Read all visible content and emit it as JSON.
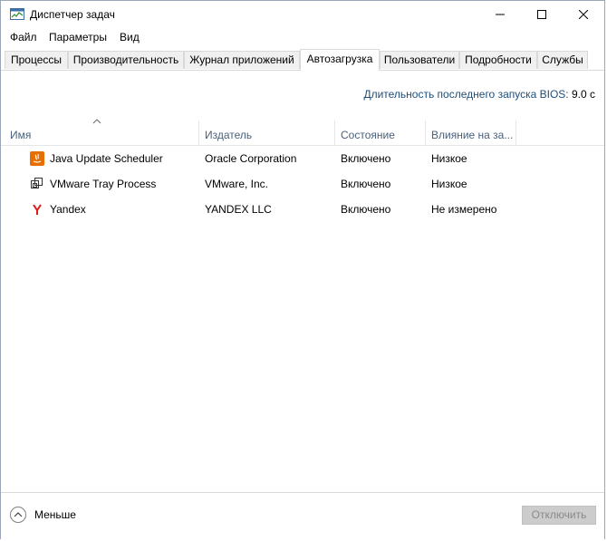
{
  "window": {
    "title": "Диспетчер задач"
  },
  "menu": [
    "Файл",
    "Параметры",
    "Вид"
  ],
  "tabs": [
    {
      "label": "Процессы",
      "active": false
    },
    {
      "label": "Производительность",
      "active": false
    },
    {
      "label": "Журнал приложений",
      "active": false
    },
    {
      "label": "Автозагрузка",
      "active": true
    },
    {
      "label": "Пользователи",
      "active": false
    },
    {
      "label": "Подробности",
      "active": false
    },
    {
      "label": "Службы",
      "active": false
    }
  ],
  "bios": {
    "label": "Длительность последнего запуска BIOS:",
    "value": "9.0 с"
  },
  "table": {
    "columns": [
      "Имя",
      "Издатель",
      "Состояние",
      "Влияние на за..."
    ],
    "sorted_column": "Имя",
    "rows": [
      {
        "icon": "java-icon",
        "name": "Java Update Scheduler",
        "publisher": "Oracle Corporation",
        "status": "Включено",
        "impact": "Низкое"
      },
      {
        "icon": "vmware-icon",
        "name": "VMware Tray Process",
        "publisher": "VMware, Inc.",
        "status": "Включено",
        "impact": "Низкое"
      },
      {
        "icon": "yandex-icon",
        "name": "Yandex",
        "publisher": "YANDEX LLC",
        "status": "Включено",
        "impact": "Не измерено"
      }
    ]
  },
  "footer": {
    "less_label": "Меньше",
    "disable_label": "Отключить"
  },
  "colors": {
    "header_text": "#4c607a",
    "bios_label": "#1f4e79",
    "disabled_button_bg": "#cccccc",
    "java_orange": "#e76f00",
    "yandex_red": "#e21b1b"
  }
}
